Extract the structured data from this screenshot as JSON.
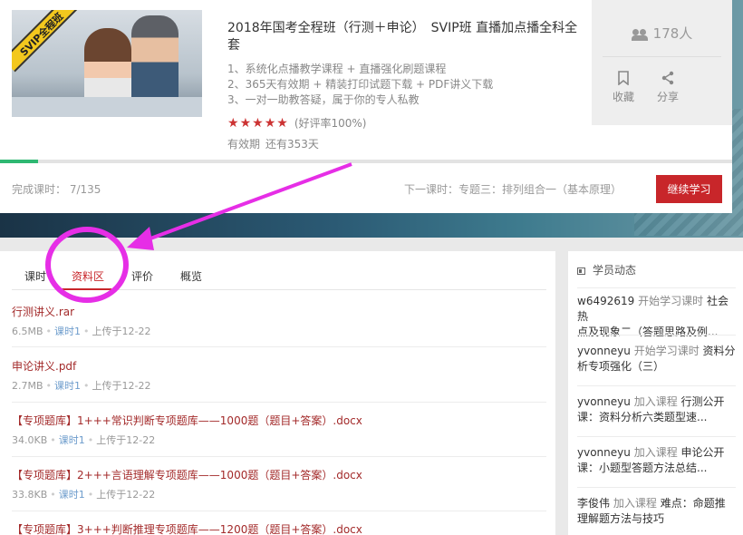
{
  "course": {
    "badge": "SVIP全程班",
    "title": "2018年国考全程班（行测＋申论）　SVIP班 直播加点播全科全套",
    "features": [
      "1、系统化点播教学课程 + 直播强化刷题课程",
      "2、365天有效期 + 精装打印试题下载 + PDF讲义下载",
      "3、一对一助教答疑，属于你的专人私教"
    ],
    "stars": 5,
    "rating_text": "(好评率100%)",
    "validity_label": "有效期",
    "validity_value": "还有353天",
    "students": "178人",
    "collect_label": "收藏",
    "share_label": "分享",
    "progress": 0.0519,
    "completed": "完成课时：  7/135",
    "next_lesson": "下一课时：专题三：排列组合一（基本原理）",
    "continue_label": "继续学习"
  },
  "tabs": [
    {
      "label": "课时"
    },
    {
      "label": "资料区"
    },
    {
      "label": "评价"
    },
    {
      "label": "概览"
    }
  ],
  "files": [
    {
      "name": "行测讲义.rar",
      "size": "6.5MB",
      "lesson": "课时1",
      "uploaded": "上传于12-22"
    },
    {
      "name": "申论讲义.pdf",
      "size": "2.7MB",
      "lesson": "课时1",
      "uploaded": "上传于12-22"
    },
    {
      "name": "【专项题库】1+++常识判断专项题库——1000题（题目+答案）.docx",
      "size": "34.0KB",
      "lesson": "课时1",
      "uploaded": "上传于12-22"
    },
    {
      "name": "【专项题库】2+++言语理解专项题库——1000题（题目+答案）.docx",
      "size": "33.8KB",
      "lesson": "课时1",
      "uploaded": "上传于12-22"
    },
    {
      "name": "【专项题库】3+++判断推理专项题库——1200题（题目+答案）.docx",
      "size": "",
      "lesson": "",
      "uploaded": ""
    }
  ],
  "activity": {
    "title": "学员动态",
    "items": [
      {
        "user": "w6492619",
        "verb": "开始学习课时",
        "line1": "社会热",
        "line2": "点及现象二（答题思路及例..."
      },
      {
        "user": "yvonneyu",
        "verb": "开始学习课时",
        "line1": "资料分",
        "line2": "析专项强化（三）"
      },
      {
        "user": "yvonneyu",
        "verb": "加入课程",
        "line1": "行测公开",
        "line2": "课：资料分析六类题型速..."
      },
      {
        "user": "yvonneyu",
        "verb": "加入课程",
        "line1": "申论公开",
        "line2": "课：小题型答题方法总结..."
      },
      {
        "user": "李俊伟",
        "verb": "加入课程",
        "line1": "难点：命题推",
        "line2": "理解题方法与技巧"
      }
    ]
  },
  "colors": {
    "accent_red": "#c8262a",
    "annotation_magenta": "#e62ee6",
    "progress_green": "#2eb872",
    "file_link": "#a32a2a",
    "lesson_link": "#6d9ccc"
  }
}
